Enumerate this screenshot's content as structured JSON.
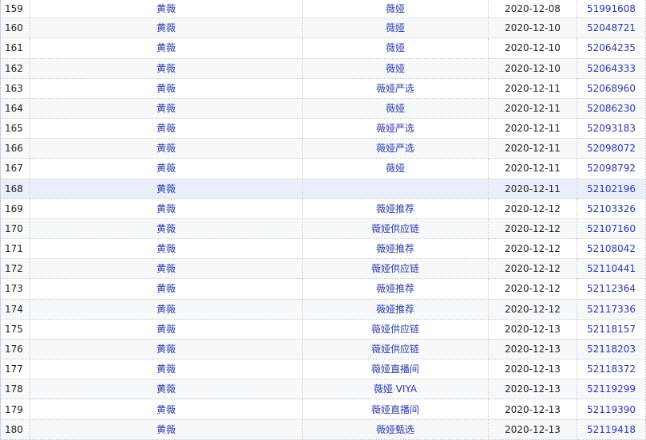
{
  "table": {
    "rows": [
      {
        "index": "159",
        "name": "黄薇",
        "store": "薇娅",
        "date": "2020-12-08",
        "id": "51991608"
      },
      {
        "index": "160",
        "name": "黄薇",
        "store": "薇娅",
        "date": "2020-12-10",
        "id": "52048721"
      },
      {
        "index": "161",
        "name": "黄薇",
        "store": "薇娅",
        "date": "2020-12-10",
        "id": "52064235"
      },
      {
        "index": "162",
        "name": "黄薇",
        "store": "薇娅",
        "date": "2020-12-10",
        "id": "52064333"
      },
      {
        "index": "163",
        "name": "黄薇",
        "store": "薇娅严选",
        "date": "2020-12-11",
        "id": "52068960"
      },
      {
        "index": "164",
        "name": "黄薇",
        "store": "薇娅",
        "date": "2020-12-11",
        "id": "52086230"
      },
      {
        "index": "165",
        "name": "黄薇",
        "store": "薇娅严选",
        "date": "2020-12-11",
        "id": "52093183"
      },
      {
        "index": "166",
        "name": "黄薇",
        "store": "薇娅严选",
        "date": "2020-12-11",
        "id": "52098072"
      },
      {
        "index": "167",
        "name": "黄薇",
        "store": "薇娅",
        "date": "2020-12-11",
        "id": "52098792"
      },
      {
        "index": "168",
        "name": "黄薇",
        "store": "",
        "date": "2020-12-11",
        "id": "52102196",
        "highlighted": true
      },
      {
        "index": "169",
        "name": "黄薇",
        "store": "薇娅推荐",
        "date": "2020-12-12",
        "id": "52103326"
      },
      {
        "index": "170",
        "name": "黄薇",
        "store": "薇娅供应链",
        "date": "2020-12-12",
        "id": "52107160"
      },
      {
        "index": "171",
        "name": "黄薇",
        "store": "薇娅推荐",
        "date": "2020-12-12",
        "id": "52108042"
      },
      {
        "index": "172",
        "name": "黄薇",
        "store": "薇娅供应链",
        "date": "2020-12-12",
        "id": "52110441"
      },
      {
        "index": "173",
        "name": "黄薇",
        "store": "薇娅推荐",
        "date": "2020-12-12",
        "id": "52112364"
      },
      {
        "index": "174",
        "name": "黄薇",
        "store": "薇娅推荐",
        "date": "2020-12-12",
        "id": "52117336"
      },
      {
        "index": "175",
        "name": "黄薇",
        "store": "薇娅供应链",
        "date": "2020-12-13",
        "id": "52118157"
      },
      {
        "index": "176",
        "name": "黄薇",
        "store": "薇娅供应链",
        "date": "2020-12-13",
        "id": "52118203"
      },
      {
        "index": "177",
        "name": "黄薇",
        "store": "薇娅直播间",
        "date": "2020-12-13",
        "id": "52118372"
      },
      {
        "index": "178",
        "name": "黄薇",
        "store": "薇娅 VIYA",
        "date": "2020-12-13",
        "id": "52119299"
      },
      {
        "index": "179",
        "name": "黄薇",
        "store": "薇娅直播间",
        "date": "2020-12-13",
        "id": "52119390"
      },
      {
        "index": "180",
        "name": "黄薇",
        "store": "薇娅甄选",
        "date": "2020-12-13",
        "id": "52119418"
      }
    ]
  }
}
